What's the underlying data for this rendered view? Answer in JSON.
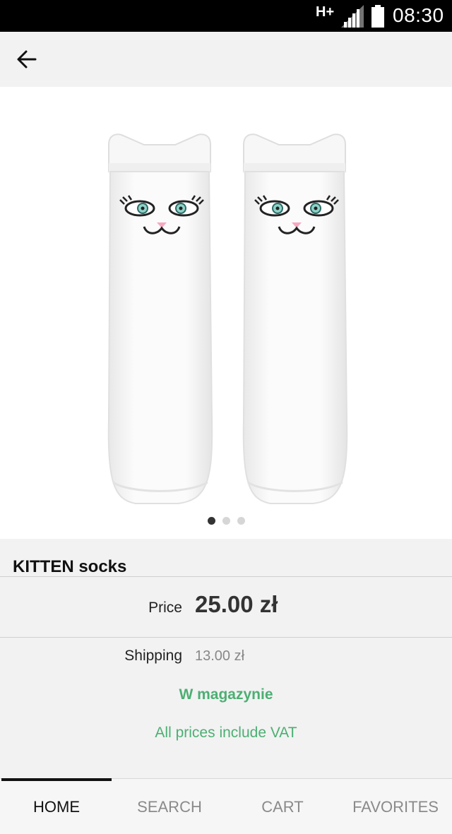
{
  "status_bar": {
    "network": "H+",
    "time": "08:30"
  },
  "app_bar": {
    "back_icon": "arrow-left-icon"
  },
  "gallery": {
    "image_description": "white-kitten-socks",
    "page_count": 3,
    "active_page": 1
  },
  "product": {
    "title": "KITTEN socks",
    "price_label": "Price",
    "price_value": "25.00 zł",
    "shipping_label": "Shipping",
    "shipping_value": "13.00 zł",
    "stock_status": "W magazynie",
    "vat_note": "All prices include VAT"
  },
  "colors": {
    "accent_green": "#4caf73",
    "nav_active": "#111111",
    "nav_inactive": "#8a8a8a"
  },
  "bottom_nav": {
    "tabs": [
      {
        "label": "HOME",
        "active": true
      },
      {
        "label": "SEARCH",
        "active": false
      },
      {
        "label": "CART",
        "active": false
      },
      {
        "label": "FAVORITES",
        "active": false
      }
    ]
  }
}
